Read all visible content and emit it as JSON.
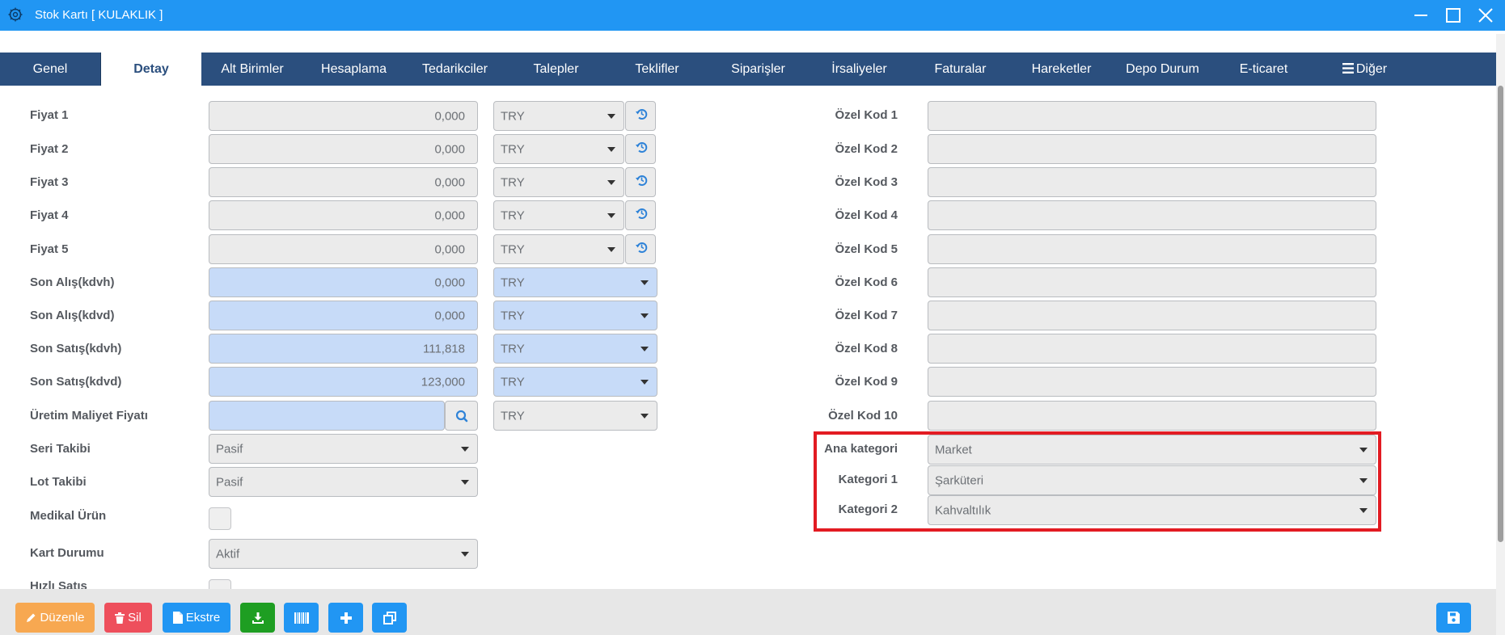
{
  "window": {
    "title": "Stok Kartı [ KULAKLIK ]"
  },
  "tabs": [
    "Genel",
    "Detay",
    "Alt Birimler",
    "Hesaplama",
    "Tedarikciler",
    "Talepler",
    "Teklifler",
    "Siparişler",
    "İrsaliyeler",
    "Faturalar",
    "Hareketler",
    "Depo Durum",
    "E-ticaret",
    "Diğer"
  ],
  "active_tab": "Detay",
  "prices": [
    {
      "label": "Fiyat 1",
      "value": "0,000",
      "currency": "TRY"
    },
    {
      "label": "Fiyat 2",
      "value": "0,000",
      "currency": "TRY"
    },
    {
      "label": "Fiyat 3",
      "value": "0,000",
      "currency": "TRY"
    },
    {
      "label": "Fiyat 4",
      "value": "0,000",
      "currency": "TRY"
    },
    {
      "label": "Fiyat 5",
      "value": "0,000",
      "currency": "TRY"
    }
  ],
  "last_prices": [
    {
      "label": "Son Alış(kdvh)",
      "value": "0,000",
      "currency": "TRY"
    },
    {
      "label": "Son Alış(kdvd)",
      "value": "0,000",
      "currency": "TRY"
    },
    {
      "label": "Son Satış(kdvh)",
      "value": "111,818",
      "currency": "TRY"
    },
    {
      "label": "Son Satış(kdvd)",
      "value": "123,000",
      "currency": "TRY"
    }
  ],
  "production_cost": {
    "label": "Üretim Maliyet Fiyatı",
    "value": "",
    "currency": "TRY"
  },
  "seri_takibi": {
    "label": "Seri Takibi",
    "value": "Pasif"
  },
  "lot_takibi": {
    "label": "Lot Takibi",
    "value": "Pasif"
  },
  "medikal_urun": {
    "label": "Medikal Ürün"
  },
  "kart_durumu": {
    "label": "Kart Durumu",
    "value": "Aktif"
  },
  "hizli_satis": {
    "label": "Hızlı Satış"
  },
  "ozel_kodlar": [
    "Özel Kod 1",
    "Özel Kod 2",
    "Özel Kod 3",
    "Özel Kod 4",
    "Özel Kod 5",
    "Özel Kod 6",
    "Özel Kod 7",
    "Özel Kod 8",
    "Özel Kod 9",
    "Özel Kod 10"
  ],
  "categories": [
    {
      "label": "Ana kategori",
      "value": "Market"
    },
    {
      "label": "Kategori 1",
      "value": "Şarküteri"
    },
    {
      "label": "Kategori 2",
      "value": "Kahvaltılık"
    }
  ],
  "toolbar": {
    "edit": "Düzenle",
    "delete": "Sil",
    "statement": "Ekstre"
  },
  "colors": {
    "titlebar": "#2196f3",
    "tabbar": "#2b4f7e",
    "highlight": "#e21b22",
    "edit": "#f7a851",
    "delete": "#ee4f5c",
    "blue": "#2196f3",
    "green": "#1e9e22"
  }
}
